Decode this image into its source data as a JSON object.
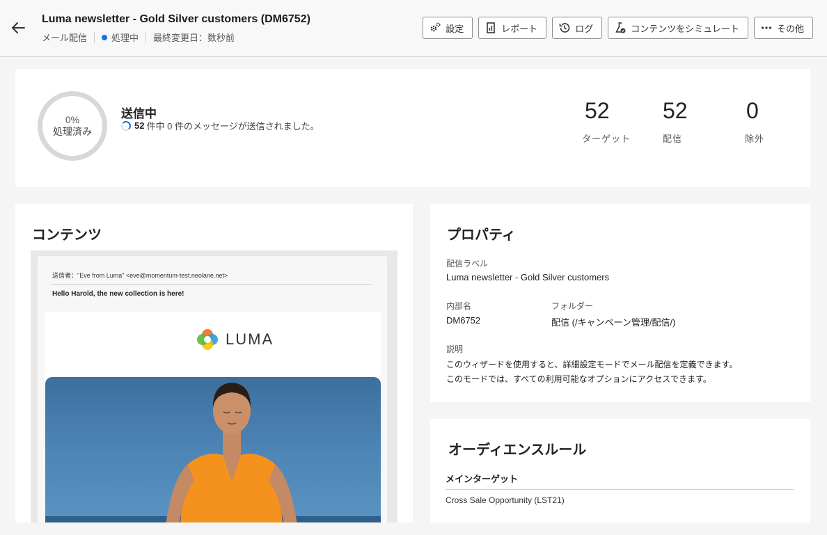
{
  "header": {
    "title": "Luma newsletter - Gold Silver customers (DM6752)",
    "channel": "メール配信",
    "status": "処理中",
    "last_modified": "最終変更日：数秒前",
    "actions": {
      "settings": "設定",
      "report": "レポート",
      "log": "ログ",
      "simulate": "コンテンツをシミュレート",
      "more": "その他"
    }
  },
  "status_card": {
    "progress_percent": "0%",
    "progress_label": "処理済み",
    "title": "送信中",
    "message_count": "52",
    "message_text": "件中 0 件のメッセージが送信されました。",
    "metrics": [
      {
        "value": "52",
        "label": "ターゲット"
      },
      {
        "value": "52",
        "label": "配信"
      },
      {
        "value": "0",
        "label": "除外"
      }
    ]
  },
  "content_card": {
    "title": "コンテンツ",
    "sender": "送信者：\"Eve from Luma\" <eve@momentum-test.neolane.net>",
    "subject": "Hello Harold, the new collection is here!",
    "logo_text": "LUMA"
  },
  "properties_card": {
    "title": "プロパティ",
    "delivery_label_caption": "配信ラベル",
    "delivery_label_value": "Luma newsletter - Gold Silver customers",
    "internal_name_caption": "内部名",
    "internal_name_value": "DM6752",
    "folder_caption": "フォルダー",
    "folder_value": "配信 (/キャンペーン管理/配信/)",
    "description_caption": "説明",
    "description_line1": "このウィザードを使用すると、詳細設定モードでメール配信を定義できます。",
    "description_line2": "このモードでは、すべての利用可能なオプションにアクセスできます。"
  },
  "audience_card": {
    "title": "オーディエンスルール",
    "main_target_caption": "メインターゲット",
    "main_target_value": "Cross Sale Opportunity (LST21)"
  },
  "colors": {
    "accent": "#1473e6",
    "ring": "#d8d8d8"
  }
}
